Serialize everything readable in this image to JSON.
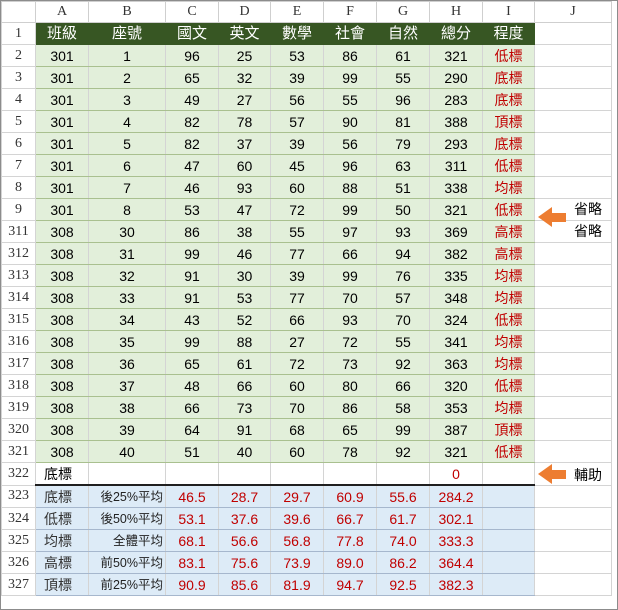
{
  "columns": [
    "A",
    "B",
    "C",
    "D",
    "E",
    "F",
    "G",
    "H",
    "I",
    "J"
  ],
  "header": {
    "row_number": "1",
    "cells": [
      "班級",
      "座號",
      "國文",
      "英文",
      "數學",
      "社會",
      "自然",
      "總分",
      "程度"
    ]
  },
  "rows": [
    {
      "row": "2",
      "cells": [
        "301",
        "1",
        "96",
        "25",
        "53",
        "86",
        "61",
        "321",
        "低標"
      ]
    },
    {
      "row": "3",
      "cells": [
        "301",
        "2",
        "65",
        "32",
        "39",
        "99",
        "55",
        "290",
        "底標"
      ]
    },
    {
      "row": "4",
      "cells": [
        "301",
        "3",
        "49",
        "27",
        "56",
        "55",
        "96",
        "283",
        "底標"
      ]
    },
    {
      "row": "5",
      "cells": [
        "301",
        "4",
        "82",
        "78",
        "57",
        "90",
        "81",
        "388",
        "頂標"
      ]
    },
    {
      "row": "6",
      "cells": [
        "301",
        "5",
        "82",
        "37",
        "39",
        "56",
        "79",
        "293",
        "底標"
      ]
    },
    {
      "row": "7",
      "cells": [
        "301",
        "6",
        "47",
        "60",
        "45",
        "96",
        "63",
        "311",
        "低標"
      ]
    },
    {
      "row": "8",
      "cells": [
        "301",
        "7",
        "46",
        "93",
        "60",
        "88",
        "51",
        "338",
        "均標"
      ]
    },
    {
      "row": "9",
      "cells": [
        "301",
        "8",
        "53",
        "47",
        "72",
        "99",
        "50",
        "321",
        "低標"
      ]
    },
    {
      "row": "311",
      "cells": [
        "308",
        "30",
        "86",
        "38",
        "55",
        "97",
        "93",
        "369",
        "高標"
      ]
    },
    {
      "row": "312",
      "cells": [
        "308",
        "31",
        "99",
        "46",
        "77",
        "66",
        "94",
        "382",
        "高標"
      ]
    },
    {
      "row": "313",
      "cells": [
        "308",
        "32",
        "91",
        "30",
        "39",
        "99",
        "76",
        "335",
        "均標"
      ]
    },
    {
      "row": "314",
      "cells": [
        "308",
        "33",
        "91",
        "53",
        "77",
        "70",
        "57",
        "348",
        "均標"
      ]
    },
    {
      "row": "315",
      "cells": [
        "308",
        "34",
        "43",
        "52",
        "66",
        "93",
        "70",
        "324",
        "低標"
      ]
    },
    {
      "row": "316",
      "cells": [
        "308",
        "35",
        "99",
        "88",
        "27",
        "72",
        "55",
        "341",
        "均標"
      ]
    },
    {
      "row": "317",
      "cells": [
        "308",
        "36",
        "65",
        "61",
        "72",
        "73",
        "92",
        "363",
        "均標"
      ]
    },
    {
      "row": "318",
      "cells": [
        "308",
        "37",
        "48",
        "66",
        "60",
        "80",
        "66",
        "320",
        "低標"
      ]
    },
    {
      "row": "319",
      "cells": [
        "308",
        "38",
        "66",
        "73",
        "70",
        "86",
        "58",
        "353",
        "均標"
      ]
    },
    {
      "row": "320",
      "cells": [
        "308",
        "39",
        "64",
        "91",
        "68",
        "65",
        "99",
        "387",
        "頂標"
      ]
    },
    {
      "row": "321",
      "cells": [
        "308",
        "40",
        "51",
        "40",
        "60",
        "78",
        "92",
        "321",
        "低標"
      ]
    }
  ],
  "helper": {
    "row": "322",
    "label": "底標",
    "value": "0"
  },
  "stats": [
    {
      "row": "323",
      "label": "底標",
      "desc": "後25%平均",
      "values": [
        "46.5",
        "28.7",
        "29.7",
        "60.9",
        "55.6",
        "284.2"
      ]
    },
    {
      "row": "324",
      "label": "低標",
      "desc": "後50%平均",
      "values": [
        "53.1",
        "37.6",
        "39.6",
        "66.7",
        "61.7",
        "302.1"
      ]
    },
    {
      "row": "325",
      "label": "均標",
      "desc": "全體平均",
      "values": [
        "68.1",
        "56.6",
        "56.8",
        "77.8",
        "74.0",
        "333.3"
      ]
    },
    {
      "row": "326",
      "label": "高標",
      "desc": "前50%平均",
      "values": [
        "83.1",
        "75.6",
        "73.9",
        "89.0",
        "86.2",
        "364.4"
      ]
    },
    {
      "row": "327",
      "label": "頂標",
      "desc": "前25%平均",
      "values": [
        "90.9",
        "85.6",
        "81.9",
        "94.7",
        "92.5",
        "382.3"
      ]
    }
  ],
  "annotations": {
    "omit_1": "省略",
    "omit_2": "省略",
    "helper": "輔助"
  },
  "colors": {
    "header_green": "#375623",
    "data_green": "#e2efda",
    "stat_blue": "#ddebf7",
    "level_red": "#c00000",
    "arrow_orange": "#ed7d31"
  }
}
